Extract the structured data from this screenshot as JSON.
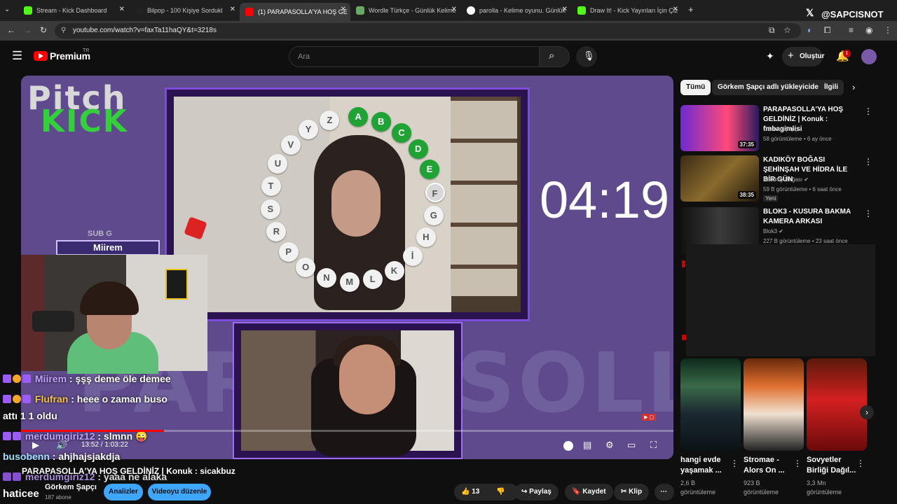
{
  "tabs": [
    {
      "title": "Stream - Kick Dashboard",
      "color": "#53fc18"
    },
    {
      "title": "Bilpop - 100 Kişiye Sordukl",
      "color": "#222222"
    },
    {
      "title": "(1) PARAPASOLLA'YA HOŞ GELİ",
      "color": "#ff0000"
    },
    {
      "title": "Wordle Türkçe - Günlük Kelime",
      "color": "#6aaa64"
    },
    {
      "title": "parolla - Kelime oyunu. Günlük",
      "color": "#ffffff"
    },
    {
      "title": "Draw It! - Kick Yayınları İçin Çiz",
      "color": "#53fc18"
    }
  ],
  "x_handle": "@SAPCISNOT",
  "url": "youtube.com/watch?v=faxTa11haQY&t=3218s",
  "youtube": {
    "logo": "Premium",
    "logo_sup": "TR",
    "search_placeholder": "Ara",
    "create_label": "Oluştur",
    "notif_count": "1"
  },
  "video": {
    "logo_top": "Pitch",
    "logo_bottom": "KICK",
    "sub_tag": "SUB G",
    "sub_name": "Miirem",
    "timer": "04:19",
    "bg_text": "PARAPASOLLA",
    "letters": [
      "A",
      "B",
      "C",
      "D",
      "E",
      "F",
      "G",
      "H",
      "İ",
      "K",
      "L",
      "M",
      "N",
      "O",
      "P",
      "R",
      "S",
      "T",
      "U",
      "V",
      "Y",
      "Z"
    ],
    "green_letters": [
      "A",
      "B",
      "C",
      "D",
      "E"
    ],
    "current_letter": "F",
    "time_current": "13:52",
    "time_total": "1:03:22",
    "progress": 0.219
  },
  "chat": [
    {
      "user": "Miirem",
      "msg": " : şşş deme öle demee"
    },
    {
      "user": "Flufran",
      "msg": " : heee o zaman buso"
    },
    {
      "user": "",
      "msg": "attı 1 1 oldu"
    },
    {
      "user": "merdumgiriz12",
      "msg": " : slmnn 😜"
    },
    {
      "user": "busobenn",
      "msg": " : ahjhajsjakdja"
    },
    {
      "user": "merdumgiriz12",
      "msg": " : yaaa ne alaka"
    }
  ],
  "chat_bottom_user": "haticee",
  "page_title": "PARAPASOLLA'YA HOŞ GELDİNİZ | Konuk : sicakbuz",
  "channel": {
    "name": "Görkem Şapçı",
    "subs": "187 abone"
  },
  "buttons": {
    "analytics": "Analizler",
    "edit": "Videoyu düzenle",
    "likes": "13",
    "share": "Paylaş",
    "save": "Kaydet",
    "clip": "Klip"
  },
  "chips": [
    "Tümü",
    "Görkem Şapçı adlı yükleyiciden",
    "İlgili"
  ],
  "recommended": [
    {
      "title": "PARAPASOLLA'YA HOŞ GELDİNİZ | Konuk : fmbagimlisi",
      "channel": "Görkem Şapçı",
      "meta": "58 görüntüleme • 6 ay önce",
      "duration": "37:35"
    },
    {
      "title": "KADIKÖY BOĞASI ŞEHİNŞAH VE HİDRA İLE BİR GÜN",
      "channel": "Kadıköy Boğası",
      "meta": "59 B görüntüleme • 6 saat önce",
      "duration": "38:35",
      "badge": "Yeni"
    },
    {
      "title": "BLOK3 - KUSURA BAKMA KAMERA ARKASI",
      "channel": "Blok3",
      "meta": "227 B görüntüleme • 23 saat önce",
      "duration": ""
    }
  ],
  "shorts": [
    {
      "title": "hangi evde yaşamak ...",
      "views": "2,6 B görüntüleme"
    },
    {
      "title": "Stromae - Alors On ...",
      "views": "923 B görüntüleme"
    },
    {
      "title": "Sovyetler Birliği Dağıl...",
      "views": "3,3 Mn görüntüleme"
    }
  ]
}
